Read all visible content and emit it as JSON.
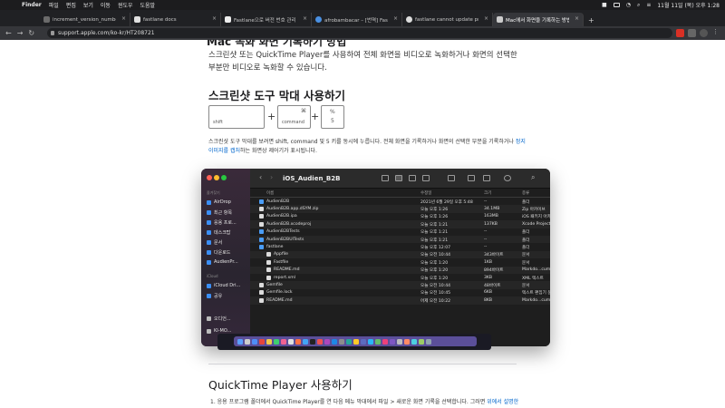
{
  "menubar": {
    "app": "Finder",
    "items": [
      "파일",
      "편집",
      "보기",
      "이동",
      "윈도우",
      "도움말"
    ],
    "clock": "11월 11일 (목) 오후 1:28"
  },
  "tabs": [
    {
      "label": "increment_version_number - ",
      "active": false
    },
    {
      "label": "fastlane docs",
      "active": false
    },
    {
      "label": "Fastlane으로 버전 번호 관리",
      "active": false
    },
    {
      "label": "afrobambacar – [번역] Fastlane으로 관",
      "active": false
    },
    {
      "label": "fastlane cannot update proje",
      "active": false
    },
    {
      "label": "Mac에서 화면을 기록하는 방법 – A",
      "active": true
    }
  ],
  "address": {
    "url": "support.apple.com/ko-kr/HT208721"
  },
  "article": {
    "cut_heading": "Mac 녹화 화면 기록하기 방법",
    "intro": "스크린샷 또는 QuickTime Player를 사용하여 전체 화면을 비디오로 녹화하거나 화면의 선택한 부분만 비디오로 녹화할 수 있습니다.",
    "section1_title": "스크린샷 도구 막대 사용하기",
    "keys": {
      "shift": "shift",
      "command_symbol": "⌘",
      "command": "command",
      "percent": "%",
      "five": "5"
    },
    "desc_part1": "스크린샷 도구 막대를 보려면 shift, command 및 5 키를 동시에 누릅니다. 전체 화면을 기록하거나 화면의 선택한 부분을 기록하거나 ",
    "desc_link": "정지 이미지를 캡처",
    "desc_part2": "하는 화면상 제어기가 표시됩니다.",
    "section2_title": "QuickTime Player 사용하기",
    "step1_prefix": "1. 응용 프로그램 폴더에서 QuickTime Player를 연 다음 메뉴 막대에서 파일 > 새로운 화면 기록을 선택합니다. 그러면 ",
    "step1_link": "위에서 설명한"
  },
  "finder": {
    "title": "iOS_Audien_B2B",
    "sidebar": {
      "favorites_label": "즐겨찾기",
      "items": [
        "AirDrop",
        "최근 항목",
        "응용 프로...",
        "데스크탑",
        "문서",
        "다운로드",
        "AudienPr..."
      ],
      "icloud_label": "iCloud",
      "icloud_items": [
        "iCloud Dri...",
        "공유"
      ],
      "location_items": [
        "오디언...",
        "KI-MO..."
      ]
    },
    "columns": {
      "name": "이름",
      "date": "수정일",
      "size": "크기",
      "kind": "종류"
    },
    "rows": [
      {
        "name": "AudienB2B",
        "date": "2021년 6월 29일 오후 5:48",
        "size": "--",
        "kind": "폴더",
        "type": "folder",
        "indent": 0
      },
      {
        "name": "AudienB2B.app.dSYM.zip",
        "date": "오늘 오후 1:26",
        "size": "34.1MB",
        "kind": "Zip 아카이브",
        "type": "file",
        "indent": 0
      },
      {
        "name": "AudienB2B.ipa",
        "date": "오늘 오후 1:26",
        "size": "163MB",
        "kind": "iOS 패키지 아카이브",
        "type": "file",
        "indent": 0
      },
      {
        "name": "AudienB2B.xcodeproj",
        "date": "오늘 오후 1:21",
        "size": "137KB",
        "kind": "Xcode Project",
        "type": "file",
        "indent": 0
      },
      {
        "name": "AudienB2BTests",
        "date": "오늘 오후 1:21",
        "size": "--",
        "kind": "폴더",
        "type": "folder",
        "indent": 0
      },
      {
        "name": "AudienB2BUITests",
        "date": "오늘 오후 1:21",
        "size": "--",
        "kind": "폴더",
        "type": "folder",
        "indent": 0
      },
      {
        "name": "fastlane",
        "date": "오늘 오후 12:07",
        "size": "--",
        "kind": "폴더",
        "type": "folder",
        "indent": 0
      },
      {
        "name": "Appfile",
        "date": "오늘 오전 10:44",
        "size": "343바이트",
        "kind": "문서",
        "type": "file",
        "indent": 1
      },
      {
        "name": "Fastfile",
        "date": "오늘 오후 1:20",
        "size": "1KB",
        "kind": "문서",
        "type": "file",
        "indent": 1
      },
      {
        "name": "README.md",
        "date": "오늘 오후 1:20",
        "size": "894바이트",
        "kind": "Markdo...cument",
        "type": "file",
        "indent": 1
      },
      {
        "name": "report.xml",
        "date": "오늘 오후 1:20",
        "size": "3KB",
        "kind": "XML 텍스트",
        "type": "file",
        "indent": 1
      },
      {
        "name": "Gemfile",
        "date": "오늘 오전 10:44",
        "size": "48바이트",
        "kind": "문서",
        "type": "file",
        "indent": 0
      },
      {
        "name": "Gemfile.lock",
        "date": "오늘 오전 10:45",
        "size": "6KB",
        "kind": "텍스트 편집기 문서",
        "type": "file",
        "indent": 0
      },
      {
        "name": "README.md",
        "date": "어제 오전 10:22",
        "size": "8KB",
        "kind": "Markdo...cument",
        "type": "file",
        "indent": 0
      }
    ]
  },
  "colors": {
    "link": "#0066cc",
    "folder": "#4a9df8",
    "tl_red": "#ff5f57",
    "tl_yellow": "#febc2e",
    "tl_green": "#28c840"
  }
}
